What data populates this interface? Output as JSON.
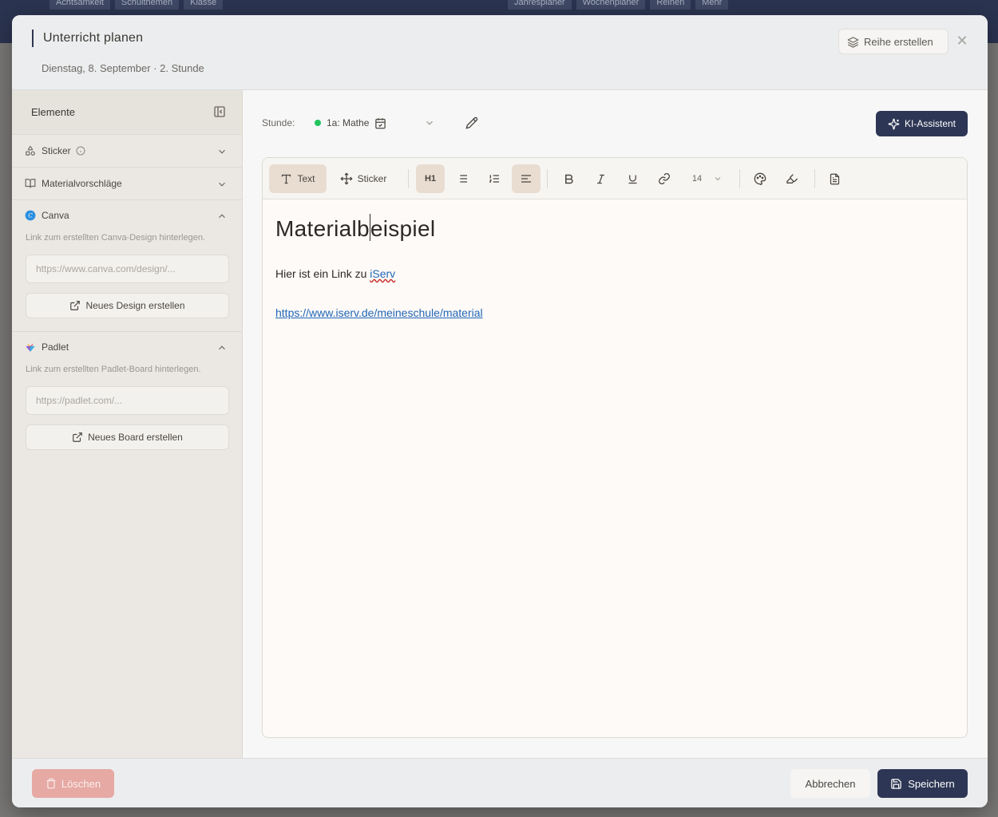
{
  "background": {
    "tabs": [
      "Achtsamkeit",
      "Schulthemen",
      "Klasse",
      "Jahresplaner",
      "Wochenplaner",
      "Reihen",
      "Mehr"
    ]
  },
  "modal": {
    "title": "Unterricht planen",
    "subtitle": "Dienstag, 8. September · 2. Stunde",
    "reihe_button": "Reihe erstellen"
  },
  "sidebar": {
    "heading": "Elemente",
    "sticker_label": "Sticker",
    "material_label": "Materialvorschläge",
    "canva": {
      "label": "Canva",
      "hint": "Link zum erstellten Canva-Design hinterlegen.",
      "placeholder": "https://www.canva.com/design/...",
      "button": "Neues Design erstellen"
    },
    "padlet": {
      "label": "Padlet",
      "hint": "Link zum erstellten Padlet-Board hinterlegen.",
      "placeholder": "https://padlet.com/...",
      "button": "Neues Board erstellen"
    }
  },
  "main": {
    "stunde_label": "Stunde:",
    "stunde_value": "1a: Mathe",
    "ki_button": "KI-Assistent"
  },
  "toolbar": {
    "text_label": "Text",
    "sticker_label": "Sticker",
    "heading_label": "H1",
    "font_size": "14"
  },
  "editor": {
    "heading_before": "Materialb",
    "heading_after": "eispiel",
    "para_text": "Hier ist ein Link zu ",
    "para_link": "iServ",
    "url": "https://www.iserv.de/meineschule/material"
  },
  "footer": {
    "delete": "Löschen",
    "cancel": "Abbrechen",
    "save": "Speichern"
  },
  "colors": {
    "primary": "#2d3654",
    "delete": "#e6a9a3",
    "link": "#2266b8",
    "status_green": "#22c55e"
  }
}
